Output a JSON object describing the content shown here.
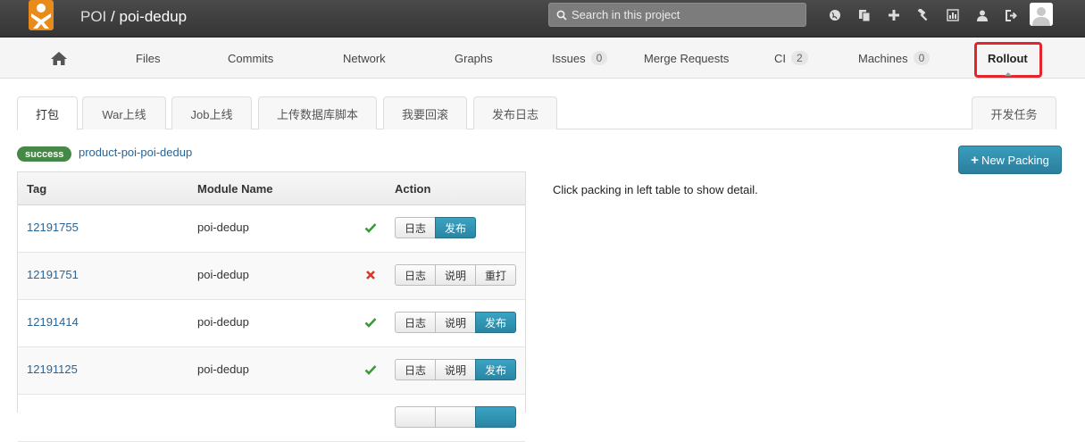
{
  "header": {
    "namespace": "POI",
    "separator": "/",
    "project": "poi-dedup",
    "search_placeholder": "Search in this project",
    "icons": [
      "globe-icon",
      "copy-icon",
      "plus-icon",
      "hammer-icon",
      "chart-icon",
      "user-icon",
      "signout-icon"
    ]
  },
  "nav": {
    "home_icon": "home-icon",
    "items": [
      {
        "label": "Files"
      },
      {
        "label": "Commits"
      },
      {
        "label": "Network"
      },
      {
        "label": "Graphs"
      },
      {
        "label": "Issues",
        "count": "0"
      },
      {
        "label": "Merge Requests"
      },
      {
        "label": "CI",
        "count": "2"
      },
      {
        "label": "Machines",
        "count": "0"
      },
      {
        "label": "Rollout",
        "active": true
      }
    ],
    "highlight_color": "#e3262d"
  },
  "tabs": {
    "items": [
      {
        "label": "打包",
        "active": true
      },
      {
        "label": "War上线"
      },
      {
        "label": "Job上线"
      },
      {
        "label": "上传数据库脚本"
      },
      {
        "label": "我要回滚"
      },
      {
        "label": "发布日志"
      }
    ],
    "right": "开发任务"
  },
  "status": {
    "badge": "success",
    "badge_color": "#468847",
    "package": "product-poi-poi-dedup"
  },
  "actions": {
    "new_packing": "New Packing",
    "new_packing_icon": "+"
  },
  "detail": {
    "hint": "Click packing in left table to show detail."
  },
  "table": {
    "headers": {
      "tag": "Tag",
      "module": "Module Name",
      "action": "Action"
    },
    "rows": [
      {
        "tag": "12191755",
        "module": "poi-dedup",
        "status": "ok",
        "buttons": [
          {
            "label": "日志"
          },
          {
            "label": "发布",
            "primary": true
          }
        ]
      },
      {
        "tag": "12191751",
        "module": "poi-dedup",
        "status": "fail",
        "buttons": [
          {
            "label": "日志"
          },
          {
            "label": "说明"
          },
          {
            "label": "重打"
          }
        ]
      },
      {
        "tag": "12191414",
        "module": "poi-dedup",
        "status": "ok",
        "buttons": [
          {
            "label": "日志"
          },
          {
            "label": "说明"
          },
          {
            "label": "发布",
            "primary": true
          }
        ]
      },
      {
        "tag": "12191125",
        "module": "poi-dedup",
        "status": "ok",
        "buttons": [
          {
            "label": "日志"
          },
          {
            "label": "说明"
          },
          {
            "label": "发布",
            "primary": true
          }
        ]
      }
    ],
    "colors": {
      "ok": "#3c9a3c",
      "fail": "#d43a2a"
    }
  }
}
